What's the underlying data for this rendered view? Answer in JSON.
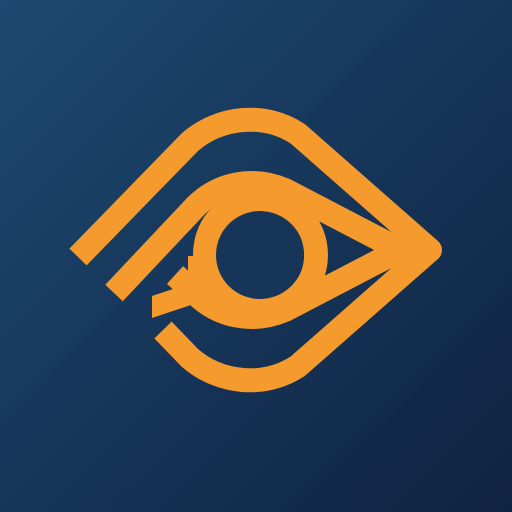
{
  "colors": {
    "background_top": "#1d4a72",
    "background_bottom": "#0f2340",
    "logo": "#f59a2c"
  },
  "icon": "eye-logo-icon"
}
